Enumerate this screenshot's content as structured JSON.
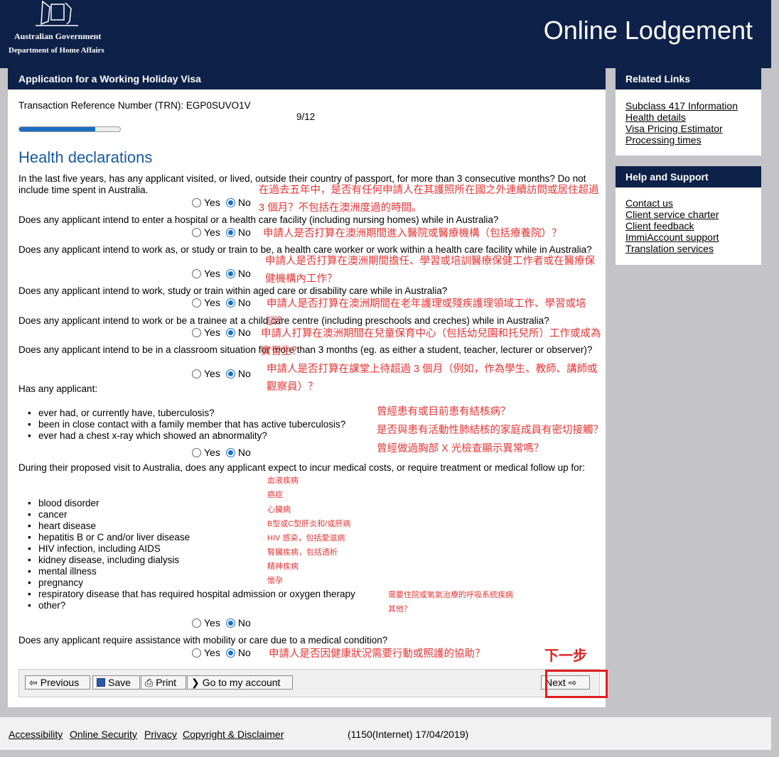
{
  "header": {
    "gov_line1": "Australian Government",
    "gov_line2": "Department of Home Affairs",
    "app_title": "Online Lodgement"
  },
  "main": {
    "heading": "Application for a Working Holiday Visa",
    "trn": "Transaction Reference Number (TRN): EGP0SUVO1V",
    "step": "9/12",
    "progress": 0.75,
    "section_title": "Health declarations",
    "radio_yes": "Yes",
    "radio_no": "No",
    "q1": "In the last five years, has any applicant visited, or lived, outside their country of passport, for more than 3 consecutive months? Do not include time spent in Australia.",
    "q2": "Does any applicant intend to enter a hospital or a health care facility (including nursing homes) while in Australia?",
    "q3": "Does any applicant intend to work as, or study or train to be, a health care worker or work within a health care facility while in Australia?",
    "q4": "Does any applicant intend to work, study or train within aged care or disability care while in Australia?",
    "q5": "Does any applicant intend to work or be a trainee at a child care centre (including preschools and creches) while in Australia?",
    "q6": "Does any applicant intend to be in a classroom situation for more than 3 months (eg. as either a student, teacher, lecturer or observer)?",
    "q7": "Has any applicant:",
    "q7_items": [
      "ever had, or currently have, tuberculosis?",
      "been in close contact with a family member that has active tuberculosis?",
      "ever had a chest x-ray which showed an abnormality?"
    ],
    "q8": "During their proposed visit to Australia, does any applicant expect to incur medical costs, or require treatment or medical follow up for:",
    "q8_items": [
      "blood disorder",
      "cancer",
      "heart disease",
      "hepatitis B or C and/or liver disease",
      "HIV infection, including AIDS",
      "kidney disease, including dialysis",
      "mental illness",
      "pregnancy",
      "respiratory disease that has required hospital admission or oxygen therapy",
      "other?"
    ],
    "q9": "Does any applicant require assistance with mobility or care due to a medical condition?"
  },
  "annotations": {
    "a1_l1": "在過去五年中，是否有任何申請人在其護照所在國之外連續訪問或居住超過",
    "a1_l2": "3 個月？不包括在澳洲度過的時間。",
    "a2": "申請人是否打算在澳洲期間進入醫院或醫療機構（包括療養院）？",
    "a3_l1": "申請人是否打算在澳洲期間擔任、學習或培訓醫療保健工作者或在醫療保",
    "a3_l2": "健機構內工作？",
    "a4": "申請人是否打算在澳洲期間在老年護理或殘疾護理領域工作、學習或培訓？",
    "a5": "申請人打算在澳洲期間在兒童保育中心（包括幼兒園和托兒所）工作或成為實習生？",
    "a6_l1": "申請人是否打算在課堂上待超過 3 個月（例如，作為學生、教師、講師或",
    "a6_l2": "觀察員）？",
    "a7_1": "曾經患有或目前患有結核病？",
    "a7_2": "是否與患有活動性肺結核的家庭成員有密切接觸？",
    "a7_3": "曾經做過胸部 X 光檢查顯示異常嗎？",
    "a8_items": [
      "血液疾病",
      "癌症",
      "心臟病",
      "B型或C型肝炎和/或肝病",
      "HIV 感染，包括愛滋病",
      "腎臟疾病，包括透析",
      "精神疾病",
      "懷孕"
    ],
    "a8_resp": "需要住院或氧氣治療的呼吸系統疾病",
    "a8_other": "其他？",
    "a9": "申請人是否因健康狀況需要行動或照護的協助？",
    "next_hint": "下一步"
  },
  "buttons": {
    "previous": "Previous",
    "save": "Save",
    "print": "Print",
    "goto_account": "Go to my account",
    "next": "Next"
  },
  "related_links": {
    "heading": "Related Links",
    "items": [
      "Subclass 417 Information",
      "Health details",
      "Visa Pricing Estimator",
      "Processing times"
    ]
  },
  "help_support": {
    "heading": "Help and Support",
    "items": [
      "Contact us",
      "Client service charter",
      "Client feedback",
      "ImmiAccount support",
      "Translation services"
    ]
  },
  "footer": {
    "links": [
      "Accessibility",
      "Online Security",
      "Privacy",
      "Copyright & Disclaimer"
    ],
    "info": "(1150(Internet) 17/04/2019)"
  },
  "colors": {
    "navy": "#0e2148",
    "accent": "#1a6fc0",
    "annotation": "#e53535"
  }
}
